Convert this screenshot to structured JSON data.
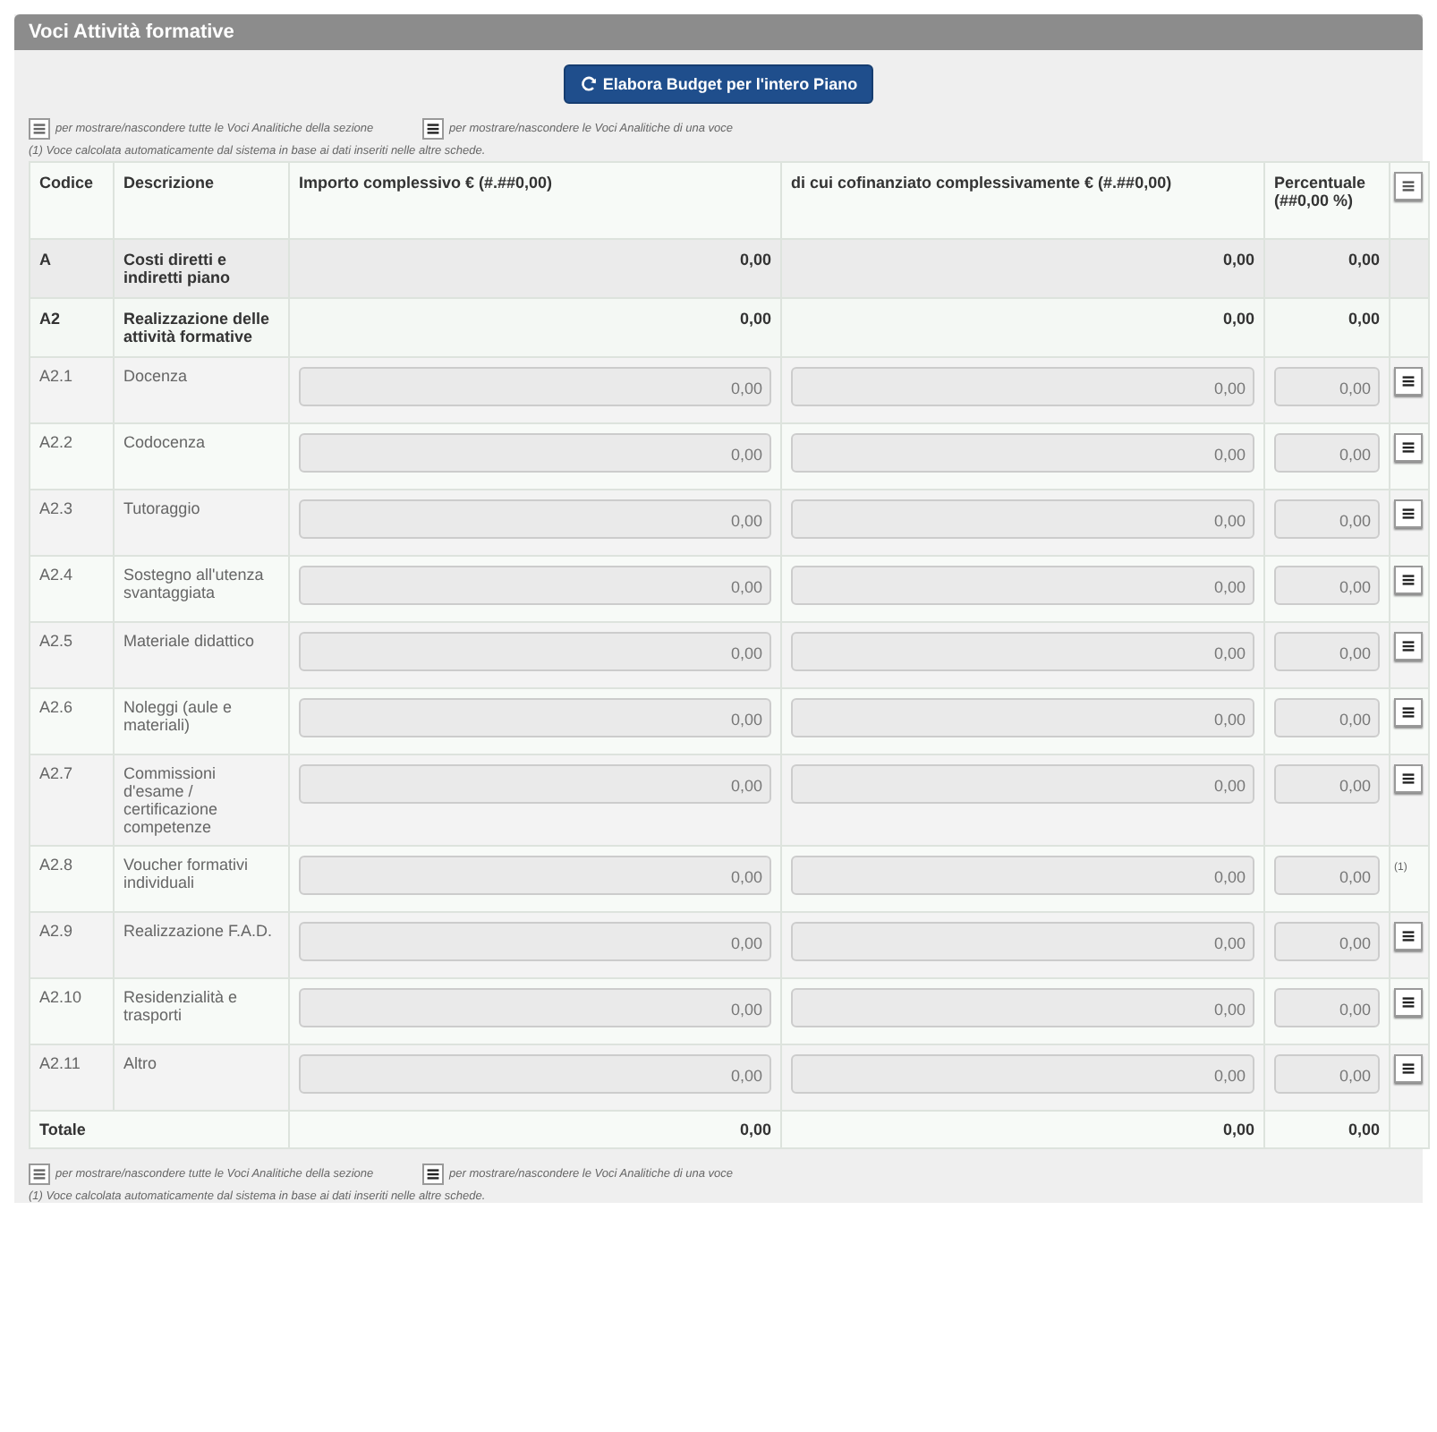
{
  "panel": {
    "title": "Voci Attività formative"
  },
  "budget_button": {
    "label": "Elabora Budget per l'intero Piano"
  },
  "legend_top": {
    "items": [
      "per mostrare/nascondere tutte le Voci Analitiche della sezione",
      "per mostrare/nascondere le Voci Analitiche di una voce"
    ],
    "note": "(1) Voce calcolata automaticamente dal sistema in base ai dati inseriti nelle altre schede."
  },
  "table": {
    "columns": [
      "Codice",
      "Descrizione",
      "Importo complessivo € (#.##0,00)",
      "di cui cofinanziato complessivamente € (#.##0,00)",
      "Percentuale (##0,00 %)"
    ],
    "rows": [
      {
        "kind": "summary",
        "code": "A",
        "description": "Costi diretti e indiretti piano",
        "amount": "0,00",
        "cofinanced": "0,00",
        "percent": "0,00"
      },
      {
        "kind": "summary",
        "code": "A2",
        "description": "Realizzazione delle attività formative",
        "amount": "0,00",
        "cofinanced": "0,00",
        "percent": "0,00"
      },
      {
        "kind": "item",
        "code": "A2.1",
        "description": "Docenza",
        "amount": "0,00",
        "cofinanced": "0,00",
        "percent": "0,00",
        "action": {
          "kind": "toggle"
        }
      },
      {
        "kind": "item",
        "code": "A2.2",
        "description": "Codocenza",
        "amount": "0,00",
        "cofinanced": "0,00",
        "percent": "0,00",
        "action": {
          "kind": "toggle"
        }
      },
      {
        "kind": "item",
        "code": "A2.3",
        "description": "Tutoraggio",
        "amount": "0,00",
        "cofinanced": "0,00",
        "percent": "0,00",
        "action": {
          "kind": "toggle"
        }
      },
      {
        "kind": "item",
        "code": "A2.4",
        "description": "Sostegno all'utenza svantaggiata",
        "amount": "0,00",
        "cofinanced": "0,00",
        "percent": "0,00",
        "action": {
          "kind": "toggle"
        }
      },
      {
        "kind": "item",
        "code": "A2.5",
        "description": "Materiale didattico",
        "amount": "0,00",
        "cofinanced": "0,00",
        "percent": "0,00",
        "action": {
          "kind": "toggle"
        }
      },
      {
        "kind": "item",
        "code": "A2.6",
        "description": "Noleggi (aule e materiali)",
        "amount": "0,00",
        "cofinanced": "0,00",
        "percent": "0,00",
        "action": {
          "kind": "toggle"
        }
      },
      {
        "kind": "item",
        "code": "A2.7",
        "description": "Commissioni d'esame / certificazione competenze",
        "amount": "0,00",
        "cofinanced": "0,00",
        "percent": "0,00",
        "action": {
          "kind": "toggle"
        }
      },
      {
        "kind": "item",
        "code": "A2.8",
        "description": "Voucher formativi individuali",
        "amount": "0,00",
        "cofinanced": "0,00",
        "percent": "0,00",
        "action": {
          "kind": "note",
          "text": "(1)"
        }
      },
      {
        "kind": "item",
        "code": "A2.9",
        "description": "Realizzazione F.A.D.",
        "amount": "0,00",
        "cofinanced": "0,00",
        "percent": "0,00",
        "action": {
          "kind": "toggle"
        }
      },
      {
        "kind": "item",
        "code": "A2.10",
        "description": "Residenzialità e trasporti",
        "amount": "0,00",
        "cofinanced": "0,00",
        "percent": "0,00",
        "action": {
          "kind": "toggle"
        }
      },
      {
        "kind": "item",
        "code": "A2.11",
        "description": "Altro",
        "amount": "0,00",
        "cofinanced": "0,00",
        "percent": "0,00",
        "action": {
          "kind": "toggle"
        }
      },
      {
        "kind": "total",
        "code": "Totale",
        "amount": "0,00",
        "cofinanced": "0,00",
        "percent": "0,00"
      }
    ]
  },
  "legend_bottom": {
    "items": [
      "per mostrare/nascondere tutte le Voci Analitiche della sezione",
      "per mostrare/nascondere le Voci Analitiche di una voce"
    ],
    "note": "(1) Voce calcolata automaticamente dal sistema in base ai dati inseriti nelle altre schede."
  }
}
